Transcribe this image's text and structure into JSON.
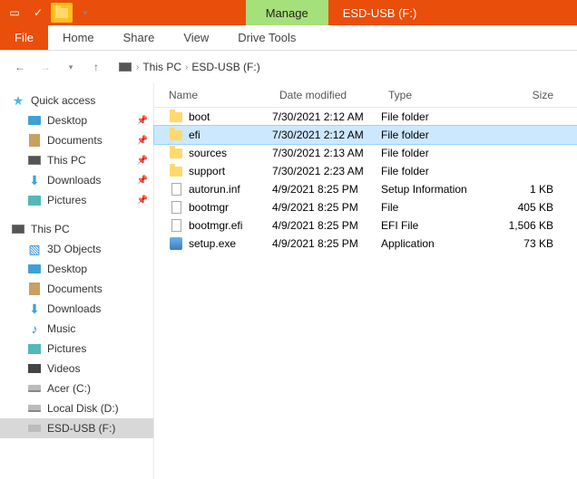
{
  "titlebar": {
    "context_tab": "Manage",
    "title": "ESD-USB (F:)"
  },
  "ribbon": {
    "file": "File",
    "tabs": [
      "Home",
      "Share",
      "View",
      "Drive Tools"
    ]
  },
  "breadcrumb": {
    "root": "This PC",
    "current": "ESD-USB (F:)"
  },
  "columns": {
    "name": "Name",
    "date": "Date modified",
    "type": "Type",
    "size": "Size"
  },
  "sidebar": {
    "quick_access": {
      "label": "Quick access",
      "items": [
        {
          "label": "Desktop",
          "icon": "desk",
          "pinned": true
        },
        {
          "label": "Documents",
          "icon": "doc",
          "pinned": true
        },
        {
          "label": "This PC",
          "icon": "pc",
          "pinned": true
        },
        {
          "label": "Downloads",
          "icon": "down",
          "pinned": true
        },
        {
          "label": "Pictures",
          "icon": "pic",
          "pinned": true
        }
      ]
    },
    "this_pc": {
      "label": "This PC",
      "items": [
        {
          "label": "3D Objects",
          "icon": "3d"
        },
        {
          "label": "Desktop",
          "icon": "desk"
        },
        {
          "label": "Documents",
          "icon": "doc"
        },
        {
          "label": "Downloads",
          "icon": "down"
        },
        {
          "label": "Music",
          "icon": "music"
        },
        {
          "label": "Pictures",
          "icon": "pic"
        },
        {
          "label": "Videos",
          "icon": "video"
        },
        {
          "label": "Acer (C:)",
          "icon": "drive"
        },
        {
          "label": "Local Disk (D:)",
          "icon": "drive"
        },
        {
          "label": "ESD-USB (F:)",
          "icon": "usb",
          "selected": true
        }
      ]
    }
  },
  "files": [
    {
      "name": "boot",
      "date": "7/30/2021 2:12 AM",
      "type": "File folder",
      "size": "",
      "icon": "folder"
    },
    {
      "name": "efi",
      "date": "7/30/2021 2:12 AM",
      "type": "File folder",
      "size": "",
      "icon": "folder",
      "selected": true
    },
    {
      "name": "sources",
      "date": "7/30/2021 2:13 AM",
      "type": "File folder",
      "size": "",
      "icon": "folder"
    },
    {
      "name": "support",
      "date": "7/30/2021 2:23 AM",
      "type": "File folder",
      "size": "",
      "icon": "folder"
    },
    {
      "name": "autorun.inf",
      "date": "4/9/2021 8:25 PM",
      "type": "Setup Information",
      "size": "1 KB",
      "icon": "file"
    },
    {
      "name": "bootmgr",
      "date": "4/9/2021 8:25 PM",
      "type": "File",
      "size": "405 KB",
      "icon": "file"
    },
    {
      "name": "bootmgr.efi",
      "date": "4/9/2021 8:25 PM",
      "type": "EFI File",
      "size": "1,506 KB",
      "icon": "file"
    },
    {
      "name": "setup.exe",
      "date": "4/9/2021 8:25 PM",
      "type": "Application",
      "size": "73 KB",
      "icon": "app"
    }
  ]
}
